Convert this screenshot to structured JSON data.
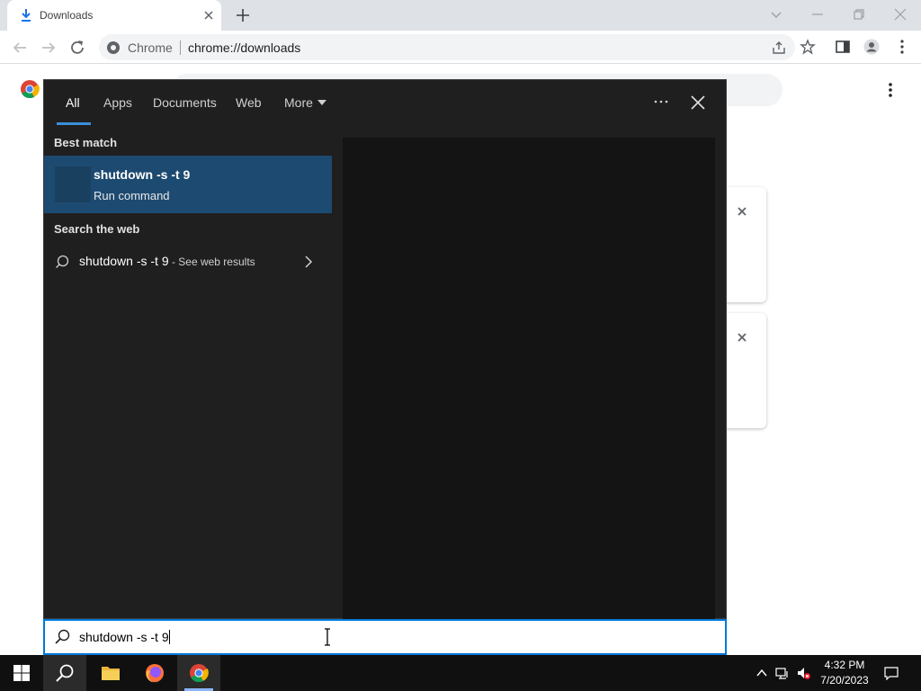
{
  "browser": {
    "tab_title": "Downloads",
    "omnibox_site": "Chrome",
    "omnibox_url": "chrome://downloads"
  },
  "search_panel": {
    "tabs": [
      "All",
      "Apps",
      "Documents",
      "Web",
      "More"
    ],
    "active_tab": "All",
    "best_match_heading": "Best match",
    "best_match_title": "shutdown -s -t 9",
    "best_match_subtitle": "Run command",
    "web_heading": "Search the web",
    "web_query": "shutdown -s -t 9",
    "web_suffix": " - See web results"
  },
  "search_box": {
    "value": "shutdown -s -t 9"
  },
  "taskbar": {
    "time": "4:32 PM",
    "date": "7/20/2023"
  },
  "colors": {
    "accent": "#0078d7",
    "best_match_bg": "#1d4a70",
    "panel_bg": "#1f1f1f",
    "taskbar_bg": "#101010"
  }
}
